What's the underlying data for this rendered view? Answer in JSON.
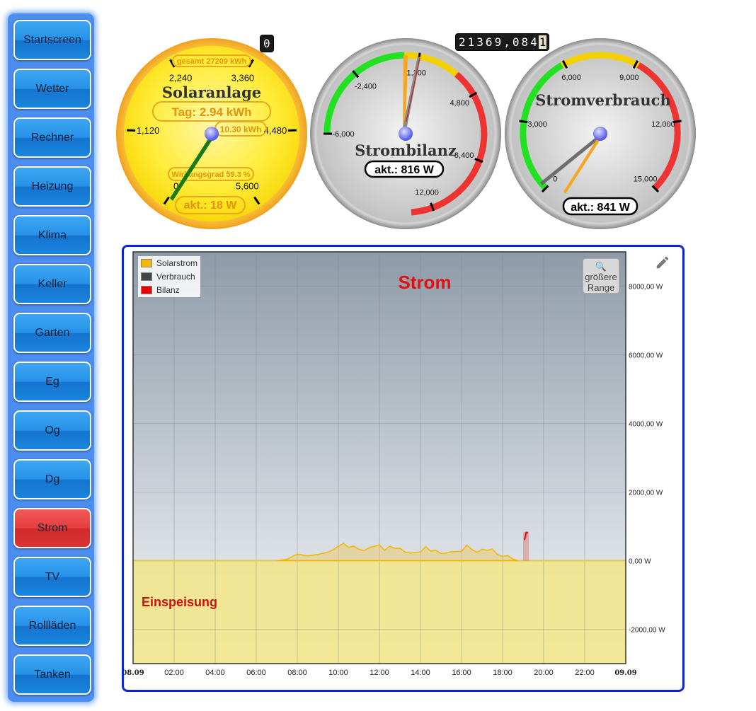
{
  "sidebar": {
    "items": [
      {
        "label": "Startscreen",
        "active": false
      },
      {
        "label": "Wetter",
        "active": false
      },
      {
        "label": "Rechner",
        "active": false
      },
      {
        "label": "Heizung",
        "active": false
      },
      {
        "label": "Klima",
        "active": false
      },
      {
        "label": "Keller",
        "active": false
      },
      {
        "label": "Garten",
        "active": false
      },
      {
        "label": "Eg",
        "active": false
      },
      {
        "label": "Og",
        "active": false
      },
      {
        "label": "Dg",
        "active": false
      },
      {
        "label": "Strom",
        "active": true
      },
      {
        "label": "TV",
        "active": false
      },
      {
        "label": "Rollläden",
        "active": false
      },
      {
        "label": "Tanken",
        "active": false
      }
    ]
  },
  "gauges": {
    "solar": {
      "title": "Solaranlage",
      "total": "gesamt 27209 kWh",
      "day": "Tag: 2.94 kWh",
      "peak": "10.30 kWh",
      "efficiency": "Wirkungsgrad 59.3 %",
      "current": "akt.: 18 W",
      "counter": "0",
      "value": 18,
      "ticks": [
        "0",
        "1,120",
        "2,240",
        "3,360",
        "4,480",
        "5,600"
      ]
    },
    "bilanz": {
      "title": "Strombilanz",
      "current": "akt.: 816 W",
      "value": 816,
      "counter_digits": [
        "2",
        "1",
        "3",
        "6",
        "9",
        ",",
        "0",
        "8",
        "4",
        "1"
      ],
      "ticks": [
        "-6,000",
        "-2,400",
        "1,200",
        "4,800",
        "8,400",
        "12,000"
      ]
    },
    "verbrauch": {
      "title": "Stromverbrauch",
      "current": "akt.: 841 W",
      "value": 841,
      "ticks": [
        "0",
        "3,000",
        "6,000",
        "9,000",
        "12,000",
        "15,000"
      ]
    }
  },
  "chart": {
    "title": "Strom",
    "range_icon": "magnifier-icon",
    "range_label": "größere Range",
    "edit_icon": "pencil-icon",
    "annotation": "Einspeisung",
    "colors": {
      "solar": "#f5b800",
      "verbrauch": "#444444",
      "bilanz": "#ee0000"
    }
  },
  "chart_data": {
    "type": "area",
    "title": "Strom",
    "series": [
      {
        "name": "Solarstrom",
        "x": [
          "07:00",
          "07:30",
          "07:45",
          "08:00",
          "08:30",
          "09:00",
          "09:30",
          "09:45",
          "10:00",
          "10:15",
          "10:30",
          "10:45",
          "11:00",
          "11:15",
          "11:30",
          "12:00",
          "12:15",
          "12:30",
          "12:45",
          "13:00",
          "13:15",
          "13:30",
          "14:00",
          "14:15",
          "14:30",
          "14:45",
          "15:00",
          "15:15",
          "15:30",
          "16:00",
          "16:15",
          "16:30",
          "16:45",
          "17:00",
          "17:15",
          "17:30",
          "17:45",
          "18:00",
          "18:15",
          "18:30",
          "18:45"
        ],
        "values": [
          0,
          40,
          120,
          190,
          140,
          180,
          250,
          320,
          420,
          500,
          390,
          420,
          330,
          290,
          380,
          460,
          300,
          420,
          360,
          360,
          250,
          220,
          250,
          410,
          280,
          300,
          210,
          220,
          260,
          270,
          450,
          330,
          240,
          330,
          300,
          340,
          180,
          120,
          150,
          50,
          0
        ]
      },
      {
        "name": "Verbrauch",
        "x": [
          "19:00",
          "19:05",
          "19:10"
        ],
        "values": [
          0,
          800,
          841
        ]
      },
      {
        "name": "Bilanz",
        "x": [
          "19:00",
          "19:05",
          "19:10"
        ],
        "values": [
          600,
          820,
          816
        ]
      }
    ],
    "x_ticks": [
      "08.09",
      "02:00",
      "04:00",
      "06:00",
      "08:00",
      "10:00",
      "12:00",
      "14:00",
      "16:00",
      "18:00",
      "20:00",
      "22:00",
      "09.09"
    ],
    "y_ticks": [
      "8000,00 W",
      "6000,00 W",
      "4000,00 W",
      "2000,00 W",
      "0,00 W",
      "-2000,00 W"
    ],
    "ylim": [
      -3000,
      9000
    ],
    "grid": true,
    "legend_position": "top-left"
  }
}
